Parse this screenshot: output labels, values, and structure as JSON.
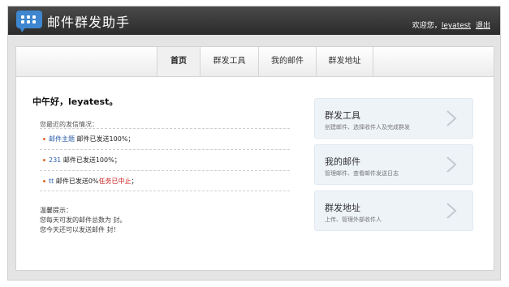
{
  "header": {
    "app_title": "邮件群发助手",
    "welcome": "欢迎您，",
    "username": "leyatest",
    "logout": "退出"
  },
  "nav": {
    "tabs": [
      {
        "label": "首页",
        "active": true
      },
      {
        "label": "群发工具",
        "active": false
      },
      {
        "label": "我的邮件",
        "active": false
      },
      {
        "label": "群发地址",
        "active": false
      }
    ]
  },
  "main": {
    "greeting": "中午好，leyatest。",
    "recent_label": "您最近的发信情况：",
    "recent": [
      {
        "subject": "邮件主题",
        "status": "邮件已发送100%",
        "extra": "；",
        "warn": ""
      },
      {
        "subject": "231",
        "status": "邮件已发送100%",
        "extra": "；",
        "warn": ""
      },
      {
        "subject": "tt",
        "status": "邮件已发送0%",
        "extra": "；",
        "warn": "任务已中止"
      }
    ],
    "tips_title": "温馨提示：",
    "tips_line1": "您每天可发的邮件总数为 封。",
    "tips_line2": "您今天还可以发送邮件 封！"
  },
  "cards": [
    {
      "title": "群发工具",
      "subtitle": "创建邮件、选择收件人及完成群发",
      "icon": "chevron-right-icon"
    },
    {
      "title": "我的邮件",
      "subtitle": "管理邮件、查看邮件发送日志",
      "icon": "chevron-right-icon"
    },
    {
      "title": "群发地址",
      "subtitle": "上传、管理外部收件人",
      "icon": "chevron-right-icon"
    }
  ],
  "colors": {
    "header_bg": "#333333",
    "logo_blue": "#3e86cf",
    "link_blue": "#2a5ca8",
    "warn_red": "#cc2222",
    "card_bg": "#eef3f8"
  }
}
